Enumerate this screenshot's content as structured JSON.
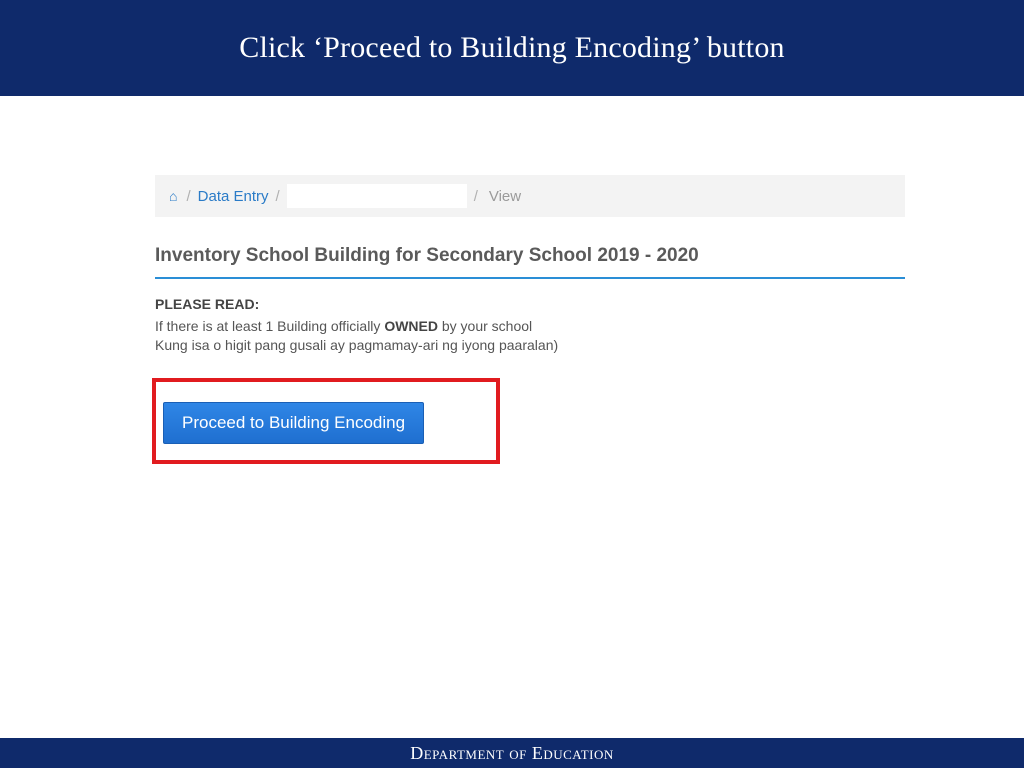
{
  "title": "Click ‘Proceed to Building Encoding’ button",
  "breadcrumb": {
    "home_icon": "⌂",
    "data_entry": "Data Entry",
    "view": "View"
  },
  "heading": "Inventory School Building for Secondary School 2019 - 2020",
  "note": {
    "label": "PLEASE READ:",
    "line1_a": "If there is at least 1 Building officially ",
    "line1_b": "OWNED",
    "line1_c": " by your school",
    "line2": "Kung isa o higit pang gusali ay pagmamay-ari ng iyong paaralan)"
  },
  "button": {
    "proceed": "Proceed to Building Encoding"
  },
  "footer": "Department of Education"
}
